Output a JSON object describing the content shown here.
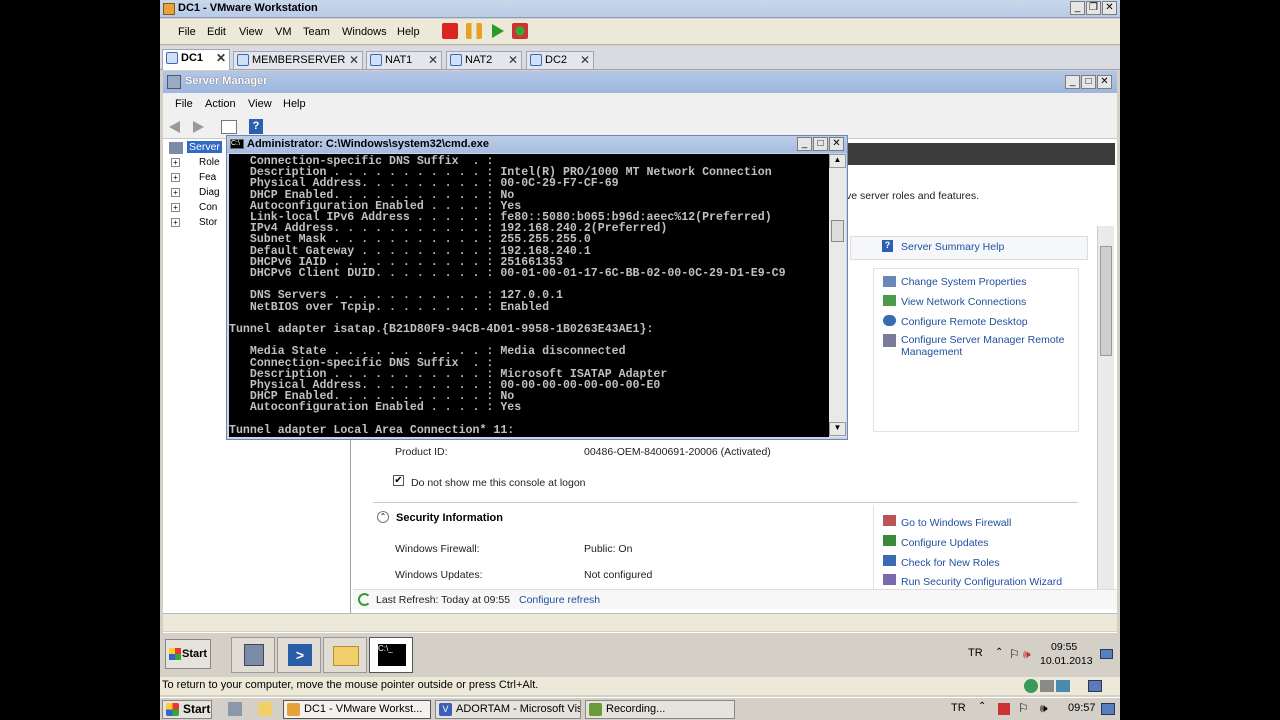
{
  "vmware": {
    "title": "DC1 - VMware Workstation",
    "menu": [
      "File",
      "Edit",
      "View",
      "VM",
      "Team",
      "Windows",
      "Help"
    ],
    "tabs": [
      "DC1",
      "MEMBERSERVER",
      "NAT1",
      "NAT2",
      "DC2"
    ],
    "hint": "To return to your computer, move the mouse pointer outside or press Ctrl+Alt."
  },
  "server_manager": {
    "title": "Server Manager",
    "menu": [
      "File",
      "Action",
      "View",
      "Help"
    ],
    "tree": [
      "Server",
      "Role",
      "Fea",
      "Diag",
      "Con",
      "Stor"
    ],
    "intro_text": "ve server roles and features.",
    "help_link": "Server Summary Help",
    "side_links": [
      "Change System Properties",
      "View Network Connections",
      "Configure Remote Desktop",
      "Configure Server Manager Remote Management"
    ],
    "product_id_label": "Product ID:",
    "product_id_value": "00486-OEM-8400691-20006 (Activated)",
    "dont_show_label": "Do not show me this console at logon",
    "dont_show_checked": true,
    "security_title": "Security Information",
    "firewall_label": "Windows Firewall:",
    "firewall_value": "Public: On",
    "updates_label": "Windows Updates:",
    "updates_value": "Not configured",
    "security_links": [
      "Go to Windows Firewall",
      "Configure Updates",
      "Check for New Roles",
      "Run Security Configuration Wizard"
    ],
    "last_refresh": "Last Refresh: Today at 09:55",
    "configure_refresh": "Configure refresh"
  },
  "cmd": {
    "title": "Administrator: C:\\Windows\\system32\\cmd.exe",
    "lines": [
      "   Connection-specific DNS Suffix  . :",
      "   Description . . . . . . . . . . . : Intel(R) PRO/1000 MT Network Connection",
      "   Physical Address. . . . . . . . . : 00-0C-29-F7-CF-69",
      "   DHCP Enabled. . . . . . . . . . . : No",
      "   Autoconfiguration Enabled . . . . : Yes",
      "   Link-local IPv6 Address . . . . . : fe80::5080:b065:b96d:aeec%12(Preferred)",
      "   IPv4 Address. . . . . . . . . . . : 192.168.240.2(Preferred)",
      "   Subnet Mask . . . . . . . . . . . : 255.255.255.0",
      "   Default Gateway . . . . . . . . . : 192.168.240.1",
      "   DHCPv6 IAID . . . . . . . . . . . : 251661353",
      "   DHCPv6 Client DUID. . . . . . . . : 00-01-00-01-17-6C-BB-02-00-0C-29-D1-E9-C9",
      "",
      "   DNS Servers . . . . . . . . . . . : 127.0.0.1",
      "   NetBIOS over Tcpip. . . . . . . . : Enabled",
      "",
      "Tunnel adapter isatap.{B21D80F9-94CB-4D01-9958-1B0263E43AE1}:",
      "",
      "   Media State . . . . . . . . . . . : Media disconnected",
      "   Connection-specific DNS Suffix  . :",
      "   Description . . . . . . . . . . . : Microsoft ISATAP Adapter",
      "   Physical Address. . . . . . . . . : 00-00-00-00-00-00-00-E0",
      "   DHCP Enabled. . . . . . . . . . . : No",
      "   Autoconfiguration Enabled . . . . : Yes",
      "",
      "Tunnel adapter Local Area Connection* 11:"
    ]
  },
  "guest_taskbar": {
    "start": "Start",
    "lang": "TR",
    "time": "09:55",
    "date": "10.01.2013"
  },
  "host_taskbar": {
    "start": "Start",
    "buttons": [
      "DC1 - VMware Workst...",
      "ADORTAM - Microsoft Visio",
      "Recording..."
    ],
    "lang": "TR",
    "time": "09:57"
  }
}
